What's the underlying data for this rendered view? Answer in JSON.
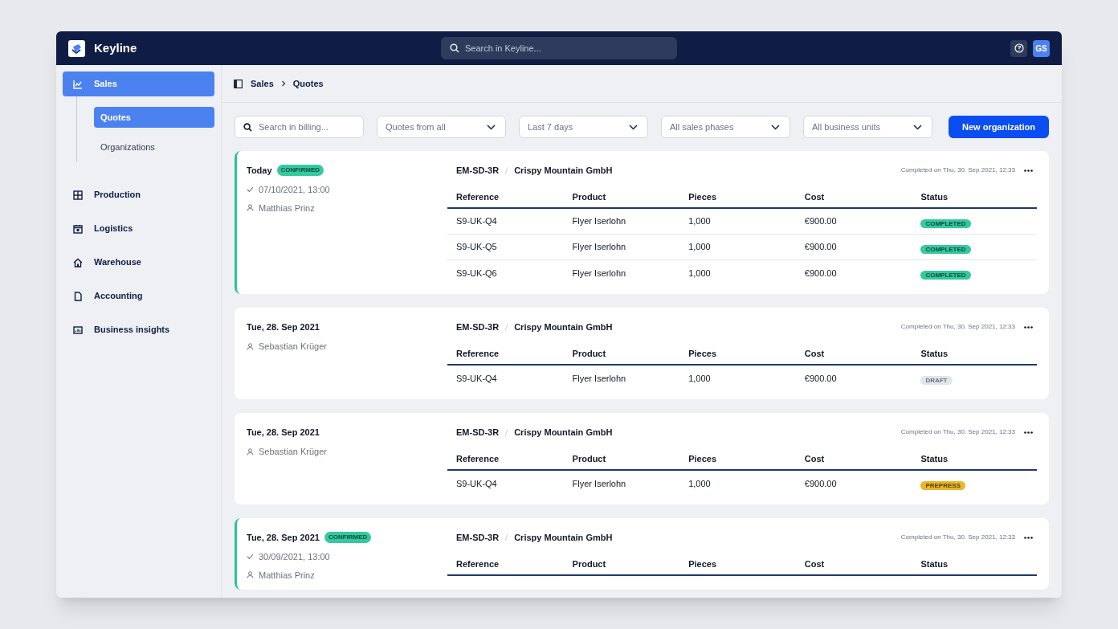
{
  "app": {
    "name": "Keyline",
    "search_placeholder": "Search in Keyline...",
    "avatar": "GS"
  },
  "sidebar": {
    "items": [
      {
        "label": "Sales",
        "selected": true,
        "children": [
          {
            "label": "Quotes",
            "selected": true
          },
          {
            "label": "Organizations",
            "selected": false
          }
        ]
      },
      {
        "label": "Production",
        "selected": false
      },
      {
        "label": "Logistics",
        "selected": false
      },
      {
        "label": "Warehouse",
        "selected": false
      },
      {
        "label": "Accounting",
        "selected": false
      },
      {
        "label": "Business insights",
        "selected": false
      }
    ]
  },
  "breadcrumb": [
    "Sales",
    "Quotes"
  ],
  "filters": {
    "search_placeholder": "Search in billing...",
    "dropdowns": [
      "Quotes from all",
      "Last 7 days",
      "All sales phases",
      "All business units"
    ],
    "button": "New organization"
  },
  "quotes": [
    {
      "date": "Today",
      "confirmed": true,
      "badge": "CONFIRMED",
      "confirmed_at": "07/10/2021, 13:00",
      "person": "Matthias Prinz",
      "code": "EM-SD-3R",
      "customer": "Crispy Mountain GmbH",
      "completed": "Completed on Thu, 30. Sep 2021, 12:33",
      "columns": [
        "Reference",
        "Product",
        "Pieces",
        "Cost",
        "Status"
      ],
      "rows": [
        {
          "reference": "S9-UK-Q4",
          "product": "Flyer Iserlohn",
          "pieces": "1,000",
          "cost": "€900.00",
          "status": "COMPLETED",
          "kind": "completed"
        },
        {
          "reference": "S9-UK-Q5",
          "product": "Flyer Iserlohn",
          "pieces": "1,000",
          "cost": "€900.00",
          "status": "COMPLETED",
          "kind": "completed"
        },
        {
          "reference": "S9-UK-Q6",
          "product": "Flyer Iserlohn",
          "pieces": "1,000",
          "cost": "€900.00",
          "status": "COMPLETED",
          "kind": "completed"
        }
      ]
    },
    {
      "date": "Tue, 28. Sep 2021",
      "confirmed": false,
      "person": "Sebastian Krüger",
      "code": "EM-SD-3R",
      "customer": "Crispy Mountain GmbH",
      "completed": "Completed on Thu, 30. Sep 2021, 12:33",
      "columns": [
        "Reference",
        "Product",
        "Pieces",
        "Cost",
        "Status"
      ],
      "rows": [
        {
          "reference": "S9-UK-Q4",
          "product": "Flyer Iserlohn",
          "pieces": "1,000",
          "cost": "€900.00",
          "status": "DRAFT",
          "kind": "draft"
        }
      ]
    },
    {
      "date": "Tue, 28. Sep 2021",
      "confirmed": false,
      "person": "Sebastian Krüger",
      "code": "EM-SD-3R",
      "customer": "Crispy Mountain GmbH",
      "completed": "Completed on Thu, 30. Sep 2021, 12:33",
      "columns": [
        "Reference",
        "Product",
        "Pieces",
        "Cost",
        "Status"
      ],
      "rows": [
        {
          "reference": "S9-UK-Q4",
          "product": "Flyer Iserlohn",
          "pieces": "1,000",
          "cost": "€900.00",
          "status": "PREPRESS",
          "kind": "prepress"
        }
      ]
    },
    {
      "date": "Tue, 28. Sep 2021",
      "confirmed": true,
      "badge": "CONFIRMED",
      "confirmed_at": "30/09/2021, 13:00",
      "person": "Matthias Prinz",
      "code": "EM-SD-3R",
      "customer": "Crispy Mountain GmbH",
      "completed": "Completed on Thu, 30. Sep 2021, 12:33",
      "columns": [
        "Reference",
        "Product",
        "Pieces",
        "Cost",
        "Status"
      ]
    }
  ]
}
